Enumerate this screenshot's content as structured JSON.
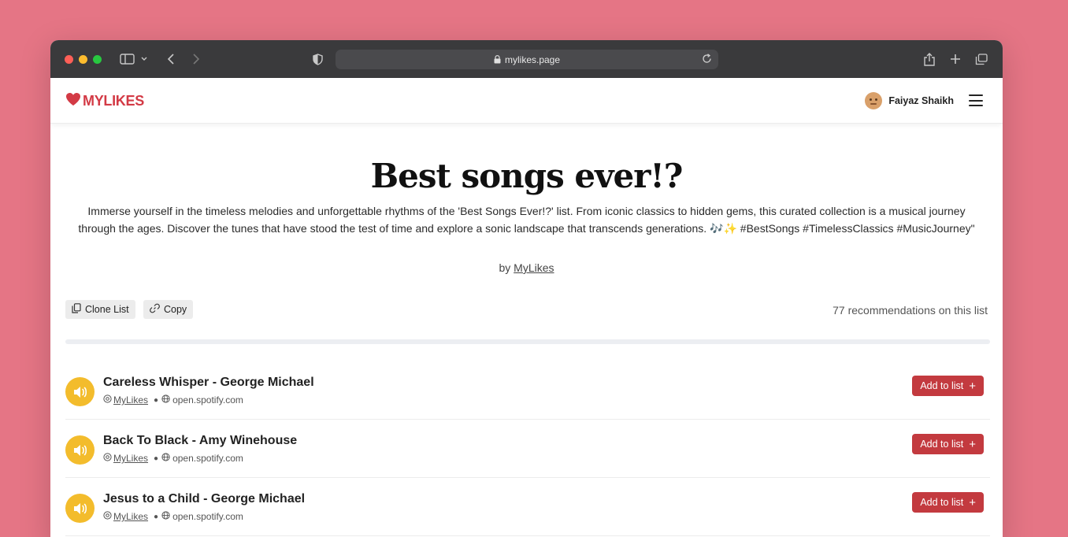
{
  "browser": {
    "url": "mylikes.page"
  },
  "header": {
    "logo_text": "MYLIKES",
    "user_name": "Faiyaz Shaikh"
  },
  "list": {
    "title": "Best songs ever!?",
    "description": "Immerse yourself in the timeless melodies and unforgettable rhythms of the 'Best Songs Ever!?' list. From iconic classics to hidden gems, this curated collection is a musical journey through the ages. Discover the tunes that have stood the test of time and explore a sonic landscape that transcends generations. 🎶✨ #BestSongs #TimelessClassics #MusicJourney\"",
    "by_prefix": "by",
    "author": "MyLikes",
    "clone_label": "Clone List",
    "copy_label": "Copy",
    "recommendations_text": "77 recommendations on this list"
  },
  "items": [
    {
      "title": "Careless Whisper - George Michael",
      "author": "MyLikes",
      "source": "open.spotify.com",
      "add_label": "Add to list"
    },
    {
      "title": "Back To Black - Amy Winehouse",
      "author": "MyLikes",
      "source": "open.spotify.com",
      "add_label": "Add to list"
    },
    {
      "title": "Jesus to a Child - George Michael",
      "author": "MyLikes",
      "source": "open.spotify.com",
      "add_label": "Add to list"
    }
  ],
  "colors": {
    "background": "#e57585",
    "brand_red": "#d33a45",
    "add_button": "#c33a3f",
    "play_yellow": "#f3bc2c"
  },
  "icons": {
    "logo": "heart-icon",
    "play": "speaker-icon",
    "clone": "copy-icon",
    "copy": "link-icon",
    "author": "at-icon",
    "source": "globe-icon"
  }
}
